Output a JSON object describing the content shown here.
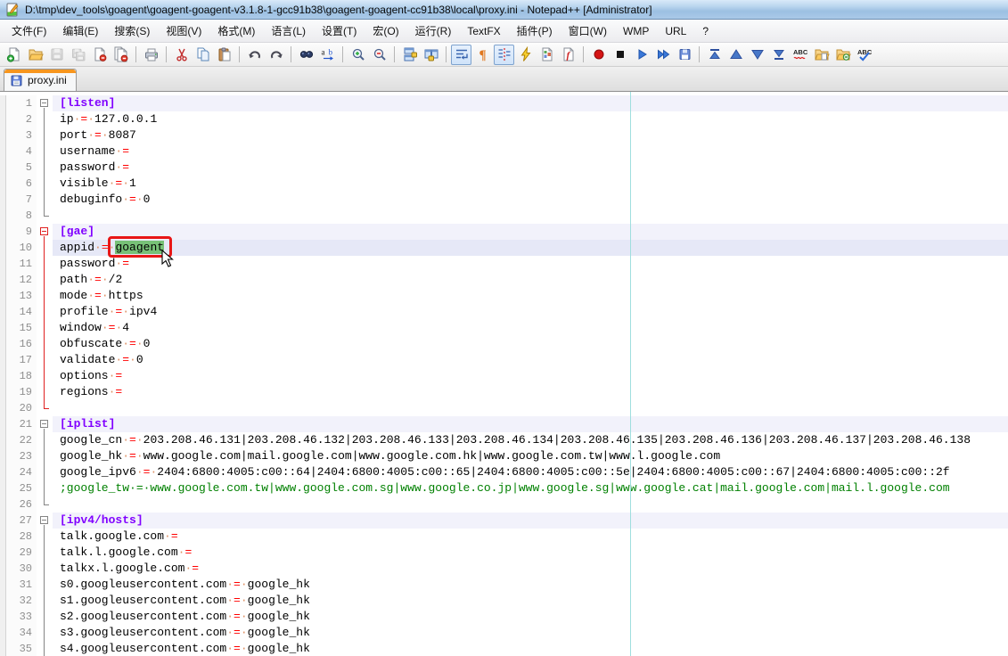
{
  "window": {
    "title": "D:\\tmp\\dev_tools\\goagent\\goagent-goagent-v3.1.8-1-gcc91b38\\goagent-goagent-cc91b38\\local\\proxy.ini - Notepad++ [Administrator]",
    "app_icon": "notepad-plus-plus-icon"
  },
  "menu": {
    "items": [
      "文件(F)",
      "编辑(E)",
      "搜索(S)",
      "视图(V)",
      "格式(M)",
      "语言(L)",
      "设置(T)",
      "宏(O)",
      "运行(R)",
      "TextFX",
      "插件(P)",
      "窗口(W)",
      "WMP",
      "URL",
      "?"
    ]
  },
  "toolbar": {
    "buttons": [
      {
        "name": "new-file-button",
        "icon": "new-file"
      },
      {
        "name": "open-file-button",
        "icon": "open-file"
      },
      {
        "name": "save-button",
        "icon": "save",
        "disabled": true
      },
      {
        "name": "save-all-button",
        "icon": "save-all",
        "disabled": true
      },
      {
        "name": "close-button",
        "icon": "close-doc"
      },
      {
        "name": "close-all-button",
        "icon": "close-all",
        "sep_after": true
      },
      {
        "name": "print-button",
        "icon": "print",
        "sep_after": true
      },
      {
        "name": "cut-button",
        "icon": "cut"
      },
      {
        "name": "copy-button",
        "icon": "copy"
      },
      {
        "name": "paste-button",
        "icon": "paste",
        "sep_after": true
      },
      {
        "name": "undo-button",
        "icon": "undo"
      },
      {
        "name": "redo-button",
        "icon": "redo",
        "sep_after": true
      },
      {
        "name": "find-button",
        "icon": "find"
      },
      {
        "name": "replace-button",
        "icon": "replace",
        "sep_after": true
      },
      {
        "name": "zoom-in-button",
        "icon": "zoom-in"
      },
      {
        "name": "zoom-out-button",
        "icon": "zoom-out",
        "sep_after": true
      },
      {
        "name": "sync-vertical-scroll-button",
        "icon": "sync-v"
      },
      {
        "name": "sync-horizontal-scroll-button",
        "icon": "sync-h",
        "sep_after": true
      },
      {
        "name": "word-wrap-button",
        "icon": "word-wrap",
        "pressed": true
      },
      {
        "name": "show-all-characters-button",
        "icon": "pilcrow"
      },
      {
        "name": "show-indent-guide-button",
        "icon": "indent-guide",
        "pressed": true
      },
      {
        "name": "user-defined-dialog-button",
        "icon": "lightning"
      },
      {
        "name": "document-map-button",
        "icon": "doc-map"
      },
      {
        "name": "function-list-button",
        "icon": "func-list",
        "sep_after": true
      },
      {
        "name": "macro-record-button",
        "icon": "record"
      },
      {
        "name": "macro-stop-button",
        "icon": "stop"
      },
      {
        "name": "macro-play-button",
        "icon": "play"
      },
      {
        "name": "macro-run-multiple-button",
        "icon": "play-multi"
      },
      {
        "name": "macro-save-button",
        "icon": "macro-save",
        "sep_after": true
      },
      {
        "name": "nav-first-button",
        "icon": "nav-first"
      },
      {
        "name": "nav-up-button",
        "icon": "nav-up"
      },
      {
        "name": "nav-down-button",
        "icon": "nav-down"
      },
      {
        "name": "nav-last-button",
        "icon": "nav-last"
      },
      {
        "name": "spell-check-button",
        "icon": "spell-abc"
      },
      {
        "name": "open-folder-button",
        "icon": "folder-doc"
      },
      {
        "name": "folder-link-button",
        "icon": "folder-link"
      },
      {
        "name": "auto-spell-check-button",
        "icon": "spell-auto"
      }
    ]
  },
  "tabs": [
    {
      "label": "proxy.ini",
      "active": true,
      "icon": "saved-file-icon"
    }
  ],
  "editor": {
    "selection_text": "goagent",
    "edge_column": 80,
    "colors": {
      "section_fg": "#8000ff",
      "assignment_fg": "#ff0000",
      "comment_fg": "#008000",
      "whitespace_fg": "#de9064",
      "selection_bg": "#77c177",
      "annotation_border": "#e81616",
      "edge_line": "#9fdede",
      "current_line_bg": "#e6e8f7",
      "section_line_bg": "#f2f2fb",
      "fold_active": "#e02020",
      "fold_normal": "#848484"
    },
    "lines": [
      {
        "n": 1,
        "f": "box",
        "fc": "g",
        "bg": "sec",
        "segs": [
          [
            "sec",
            "[listen]"
          ]
        ]
      },
      {
        "n": 2,
        "f": "line",
        "fc": "g",
        "segs": [
          [
            "def",
            "ip"
          ],
          [
            "ws",
            "·"
          ],
          [
            "asg",
            "="
          ],
          [
            "ws",
            "·"
          ],
          [
            "def",
            "127.0.0.1"
          ]
        ]
      },
      {
        "n": 3,
        "f": "line",
        "fc": "g",
        "segs": [
          [
            "def",
            "port"
          ],
          [
            "ws",
            "·"
          ],
          [
            "asg",
            "="
          ],
          [
            "ws",
            "·"
          ],
          [
            "def",
            "8087"
          ]
        ]
      },
      {
        "n": 4,
        "f": "line",
        "fc": "g",
        "segs": [
          [
            "def",
            "username"
          ],
          [
            "ws",
            "·"
          ],
          [
            "asg",
            "="
          ]
        ]
      },
      {
        "n": 5,
        "f": "line",
        "fc": "g",
        "segs": [
          [
            "def",
            "password"
          ],
          [
            "ws",
            "·"
          ],
          [
            "asg",
            "="
          ]
        ]
      },
      {
        "n": 6,
        "f": "line",
        "fc": "g",
        "segs": [
          [
            "def",
            "visible"
          ],
          [
            "ws",
            "·"
          ],
          [
            "asg",
            "="
          ],
          [
            "ws",
            "·"
          ],
          [
            "def",
            "1"
          ]
        ]
      },
      {
        "n": 7,
        "f": "line",
        "fc": "g",
        "segs": [
          [
            "def",
            "debuginfo"
          ],
          [
            "ws",
            "·"
          ],
          [
            "asg",
            "="
          ],
          [
            "ws",
            "·"
          ],
          [
            "def",
            "0"
          ]
        ]
      },
      {
        "n": 8,
        "f": "corner",
        "fc": "g",
        "segs": []
      },
      {
        "n": 9,
        "f": "box",
        "fc": "r",
        "bg": "sec",
        "segs": [
          [
            "sec",
            "[gae]"
          ]
        ]
      },
      {
        "n": 10,
        "f": "line",
        "fc": "r",
        "bg": "cur",
        "ann": true,
        "segs": [
          [
            "def",
            "appid"
          ],
          [
            "ws",
            "·"
          ],
          [
            "asg",
            "="
          ],
          [
            "ws",
            "·"
          ],
          [
            "sel",
            "goagent"
          ]
        ]
      },
      {
        "n": 11,
        "f": "line",
        "fc": "r",
        "segs": [
          [
            "def",
            "password"
          ],
          [
            "ws",
            "·"
          ],
          [
            "asg",
            "="
          ]
        ]
      },
      {
        "n": 12,
        "f": "line",
        "fc": "r",
        "segs": [
          [
            "def",
            "path"
          ],
          [
            "ws",
            "·"
          ],
          [
            "asg",
            "="
          ],
          [
            "ws",
            "·"
          ],
          [
            "def",
            "/2"
          ]
        ]
      },
      {
        "n": 13,
        "f": "line",
        "fc": "r",
        "segs": [
          [
            "def",
            "mode"
          ],
          [
            "ws",
            "·"
          ],
          [
            "asg",
            "="
          ],
          [
            "ws",
            "·"
          ],
          [
            "def",
            "https"
          ]
        ]
      },
      {
        "n": 14,
        "f": "line",
        "fc": "r",
        "segs": [
          [
            "def",
            "profile"
          ],
          [
            "ws",
            "·"
          ],
          [
            "asg",
            "="
          ],
          [
            "ws",
            "·"
          ],
          [
            "def",
            "ipv4"
          ]
        ]
      },
      {
        "n": 15,
        "f": "line",
        "fc": "r",
        "segs": [
          [
            "def",
            "window"
          ],
          [
            "ws",
            "·"
          ],
          [
            "asg",
            "="
          ],
          [
            "ws",
            "·"
          ],
          [
            "def",
            "4"
          ]
        ]
      },
      {
        "n": 16,
        "f": "line",
        "fc": "r",
        "segs": [
          [
            "def",
            "obfuscate"
          ],
          [
            "ws",
            "·"
          ],
          [
            "asg",
            "="
          ],
          [
            "ws",
            "·"
          ],
          [
            "def",
            "0"
          ]
        ]
      },
      {
        "n": 17,
        "f": "line",
        "fc": "r",
        "segs": [
          [
            "def",
            "validate"
          ],
          [
            "ws",
            "·"
          ],
          [
            "asg",
            "="
          ],
          [
            "ws",
            "·"
          ],
          [
            "def",
            "0"
          ]
        ]
      },
      {
        "n": 18,
        "f": "line",
        "fc": "r",
        "segs": [
          [
            "def",
            "options"
          ],
          [
            "ws",
            "·"
          ],
          [
            "asg",
            "="
          ]
        ]
      },
      {
        "n": 19,
        "f": "line",
        "fc": "r",
        "segs": [
          [
            "def",
            "regions"
          ],
          [
            "ws",
            "·"
          ],
          [
            "asg",
            "="
          ]
        ]
      },
      {
        "n": 20,
        "f": "corner",
        "fc": "r",
        "segs": []
      },
      {
        "n": 21,
        "f": "box",
        "fc": "g",
        "bg": "sec",
        "segs": [
          [
            "sec",
            "[iplist]"
          ]
        ]
      },
      {
        "n": 22,
        "f": "line",
        "fc": "g",
        "segs": [
          [
            "def",
            "google_cn"
          ],
          [
            "ws",
            "·"
          ],
          [
            "asg",
            "="
          ],
          [
            "ws",
            "·"
          ],
          [
            "def",
            "203.208.46.131|203.208.46.132|203.208.46.133|203.208.46.134|203.208.46.135|203.208.46.136|203.208.46.137|203.208.46.138"
          ]
        ]
      },
      {
        "n": 23,
        "f": "line",
        "fc": "g",
        "segs": [
          [
            "def",
            "google_hk"
          ],
          [
            "ws",
            "·"
          ],
          [
            "asg",
            "="
          ],
          [
            "ws",
            "·"
          ],
          [
            "def",
            "www.google.com|mail.google.com|www.google.com.hk|www.google.com.tw|www.l.google.com"
          ]
        ]
      },
      {
        "n": 24,
        "f": "line",
        "fc": "g",
        "segs": [
          [
            "def",
            "google_ipv6"
          ],
          [
            "ws",
            "·"
          ],
          [
            "asg",
            "="
          ],
          [
            "ws",
            "·"
          ],
          [
            "def",
            "2404:6800:4005:c00::64|2404:6800:4005:c00::65|2404:6800:4005:c00::5e|2404:6800:4005:c00::67|2404:6800:4005:c00::2f"
          ]
        ]
      },
      {
        "n": 25,
        "f": "line",
        "fc": "g",
        "segs": [
          [
            "cmt",
            ";google_tw·=·www.google.com.tw|www.google.com.sg|www.google.co.jp|www.google.sg|www.google.cat|mail.google.com|mail.l.google.com"
          ]
        ]
      },
      {
        "n": 26,
        "f": "corner",
        "fc": "g",
        "segs": []
      },
      {
        "n": 27,
        "f": "box",
        "fc": "g",
        "bg": "sec",
        "segs": [
          [
            "sec",
            "[ipv4/hosts]"
          ]
        ]
      },
      {
        "n": 28,
        "f": "line",
        "fc": "g",
        "segs": [
          [
            "def",
            "talk.google.com"
          ],
          [
            "ws",
            "·"
          ],
          [
            "asg",
            "="
          ]
        ]
      },
      {
        "n": 29,
        "f": "line",
        "fc": "g",
        "segs": [
          [
            "def",
            "talk.l.google.com"
          ],
          [
            "ws",
            "·"
          ],
          [
            "asg",
            "="
          ]
        ]
      },
      {
        "n": 30,
        "f": "line",
        "fc": "g",
        "segs": [
          [
            "def",
            "talkx.l.google.com"
          ],
          [
            "ws",
            "·"
          ],
          [
            "asg",
            "="
          ]
        ]
      },
      {
        "n": 31,
        "f": "line",
        "fc": "g",
        "segs": [
          [
            "def",
            "s0.googleusercontent.com"
          ],
          [
            "ws",
            "·"
          ],
          [
            "asg",
            "="
          ],
          [
            "ws",
            "·"
          ],
          [
            "def",
            "google_hk"
          ]
        ]
      },
      {
        "n": 32,
        "f": "line",
        "fc": "g",
        "segs": [
          [
            "def",
            "s1.googleusercontent.com"
          ],
          [
            "ws",
            "·"
          ],
          [
            "asg",
            "="
          ],
          [
            "ws",
            "·"
          ],
          [
            "def",
            "google_hk"
          ]
        ]
      },
      {
        "n": 33,
        "f": "line",
        "fc": "g",
        "segs": [
          [
            "def",
            "s2.googleusercontent.com"
          ],
          [
            "ws",
            "·"
          ],
          [
            "asg",
            "="
          ],
          [
            "ws",
            "·"
          ],
          [
            "def",
            "google_hk"
          ]
        ]
      },
      {
        "n": 34,
        "f": "line",
        "fc": "g",
        "segs": [
          [
            "def",
            "s3.googleusercontent.com"
          ],
          [
            "ws",
            "·"
          ],
          [
            "asg",
            "="
          ],
          [
            "ws",
            "·"
          ],
          [
            "def",
            "google_hk"
          ]
        ]
      },
      {
        "n": 35,
        "f": "line",
        "fc": "g",
        "segs": [
          [
            "def",
            "s4.googleusercontent.com"
          ],
          [
            "ws",
            "·"
          ],
          [
            "asg",
            "="
          ],
          [
            "ws",
            "·"
          ],
          [
            "def",
            "google_hk"
          ]
        ]
      }
    ]
  }
}
